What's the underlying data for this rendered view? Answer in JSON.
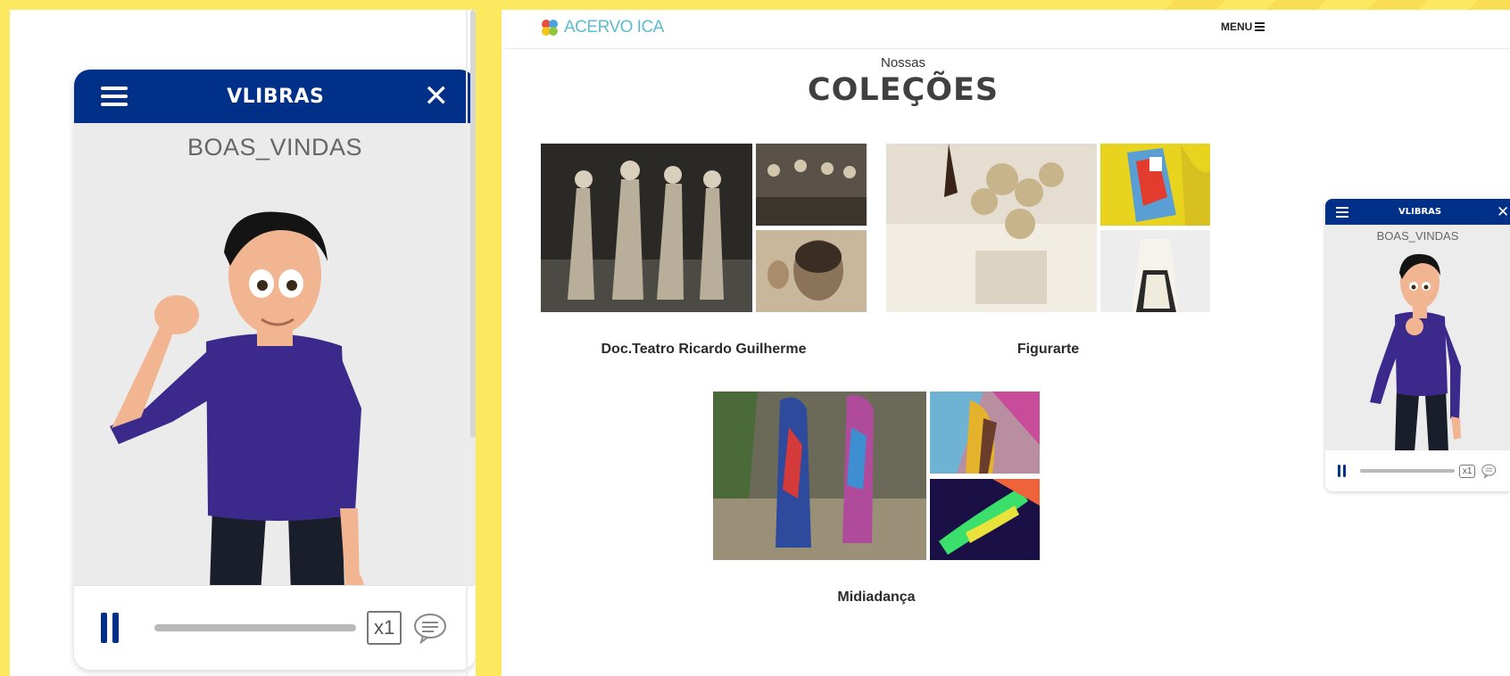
{
  "vlibras_zoom": {
    "title": "VLIBRAS",
    "gloss": "BOAS_VINDAS",
    "speed": "x1"
  },
  "site": {
    "logo_text": "ACERVO ICA",
    "menu_label": "MENU",
    "subtitle": "Nossas",
    "headline": "COLEÇÕES",
    "collections": [
      {
        "name": "Doc.Teatro Ricardo Guilherme"
      },
      {
        "name": "Figurarte"
      },
      {
        "name": "Midiadança"
      }
    ]
  },
  "vlibras_widget": {
    "title": "VLIBRAS",
    "gloss": "BOAS_VINDAS",
    "speed": "x1"
  },
  "colors": {
    "background": "#fde95f",
    "vlibras_blue": "#003087",
    "logo_teal": "#5bbdd0"
  }
}
